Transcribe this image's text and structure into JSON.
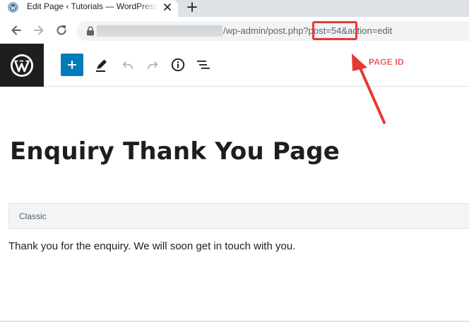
{
  "browser": {
    "tab": {
      "title": "Edit Page ‹ Tutorials — WordPress",
      "favicon": "wordpress-icon",
      "close_icon": "close-icon"
    },
    "new_tab_icon": "plus-icon",
    "nav": {
      "back_icon": "arrow-left-icon",
      "forward_icon": "arrow-right-icon",
      "reload_icon": "reload-icon"
    },
    "address": {
      "lock_icon": "lock-icon",
      "path": "/wp-admin/post.php",
      "query_id": "?post=54",
      "query_rest": "&action=edit"
    }
  },
  "editor": {
    "toolbar": {
      "logo_icon": "wordpress-logo-icon",
      "add_block_icon": "plus-icon",
      "tools_icon": "pencil-icon",
      "undo_icon": "undo-icon",
      "redo_icon": "redo-icon",
      "details_icon": "info-icon",
      "outline_icon": "list-view-icon"
    },
    "page_title": "Enquiry Thank You Page",
    "classic_block_label": "Classic",
    "content": "Thank you for the enquiry. We will soon get in touch with you."
  },
  "annotation": {
    "label": "PAGE ID",
    "color": "#e53935"
  },
  "colors": {
    "wp_dark": "#1e1e1e",
    "wp_blue": "#007cba",
    "annotation_red": "#e53935"
  }
}
